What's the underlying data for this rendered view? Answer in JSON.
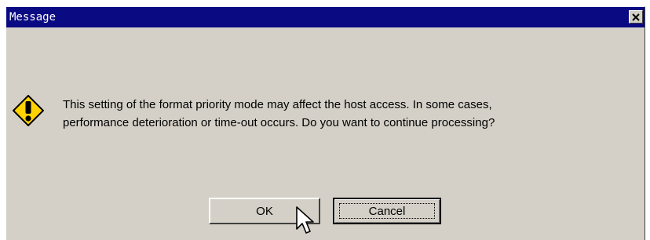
{
  "window": {
    "title": "Message",
    "close_icon": "close-icon"
  },
  "icon": "warning-exclamation-icon",
  "message": {
    "line1": "This setting of the format priority mode may affect the host access. In some cases,",
    "line2": "performance deterioration or time-out occurs. Do you want to continue processing?"
  },
  "buttons": {
    "ok_label": "OK",
    "cancel_label": "Cancel"
  },
  "colors": {
    "titlebar": "#0a0a82",
    "dialog_bg": "#d4d0c8",
    "warning_fill": "#ffd200"
  }
}
